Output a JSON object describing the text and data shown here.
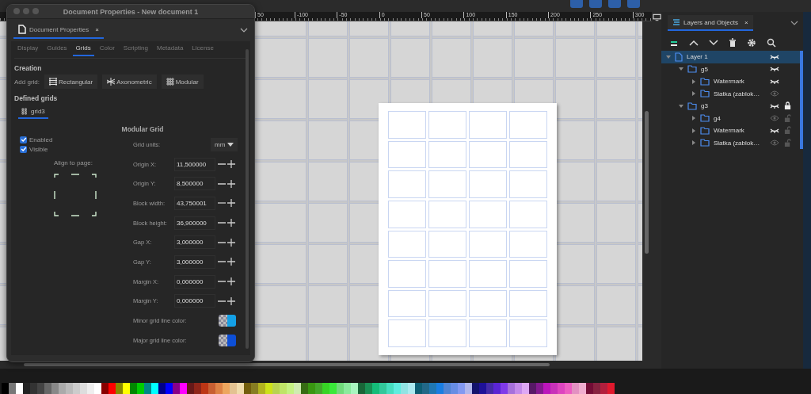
{
  "dialog": {
    "title": "Document Properties - New document 1",
    "panel_tab": "Document Properties",
    "close": "×",
    "tabs": [
      {
        "label": "Display",
        "selected": false
      },
      {
        "label": "Guides",
        "selected": false
      },
      {
        "label": "Grids",
        "selected": true
      },
      {
        "label": "Color",
        "selected": false
      },
      {
        "label": "Scripting",
        "selected": false
      },
      {
        "label": "Metadata",
        "selected": false
      },
      {
        "label": "License",
        "selected": false
      }
    ],
    "creation": {
      "heading": "Creation",
      "label": "Add grid:",
      "buttons": [
        {
          "label": "Rectangular",
          "kind": "rect"
        },
        {
          "label": "Axonometric",
          "kind": "axo"
        },
        {
          "label": "Modular",
          "kind": "modular"
        }
      ]
    },
    "defined": {
      "heading": "Defined grids",
      "grids": [
        {
          "label": "grid3",
          "selected": true
        }
      ]
    },
    "grid": {
      "heading": "Modular Grid",
      "checks": [
        {
          "label": "Enabled",
          "checked": true
        },
        {
          "label": "Visible",
          "checked": true
        }
      ],
      "align_label": "Align to page:",
      "units": {
        "label": "Grid units:",
        "value": "mm"
      },
      "fields": [
        {
          "kind": "spin",
          "label": "Origin X:",
          "value": "11,500000"
        },
        {
          "kind": "spin",
          "label": "Origin Y:",
          "value": "8,500000"
        },
        {
          "kind": "spin",
          "label": "Block width:",
          "value": "43,750001"
        },
        {
          "kind": "spin",
          "label": "Block height:",
          "value": "36,900000"
        },
        {
          "kind": "spin",
          "label": "Gap X:",
          "value": "3,000000"
        },
        {
          "kind": "spin",
          "label": "Gap Y:",
          "value": "3,000000"
        },
        {
          "kind": "spin",
          "label": "Margin X:",
          "value": "0,000000"
        },
        {
          "kind": "spin",
          "label": "Margin Y:",
          "value": "0,000000"
        },
        {
          "kind": "color",
          "label": "Minor grid line color:",
          "color": "#14a0e6"
        },
        {
          "kind": "color",
          "label": "Major grid line color:",
          "color": "#0d4fd6"
        }
      ]
    }
  },
  "ruler": {
    "left_label": "50",
    "ticks": [
      "-100",
      "-50",
      "0",
      "50",
      "100",
      "150",
      "200",
      "250",
      "300"
    ]
  },
  "layers": {
    "title": "Layers and Objects",
    "close": "×",
    "tree": [
      {
        "label": "Layer 1",
        "kind": "layer",
        "selected": true,
        "expanded": true,
        "visible": true,
        "children": [
          {
            "label": "g5",
            "kind": "group",
            "selected": false,
            "expanded": true,
            "visible": true,
            "children": [
              {
                "label": "Watermark",
                "kind": "group",
                "selected": false,
                "expanded": false,
                "visible": true
              },
              {
                "label": "Siatka (zablok…",
                "kind": "group",
                "selected": false,
                "expanded": false,
                "visible": false
              }
            ]
          },
          {
            "label": "g3",
            "kind": "group",
            "selected": false,
            "expanded": true,
            "visible": true,
            "locked": true,
            "children": [
              {
                "label": "g4",
                "kind": "group",
                "selected": false,
                "expanded": false,
                "visible": false,
                "locked": false
              },
              {
                "label": "Watermark",
                "kind": "group",
                "selected": false,
                "expanded": false,
                "visible": true,
                "locked": false
              },
              {
                "label": "Siatka (zablok…",
                "kind": "group",
                "selected": false,
                "expanded": false,
                "visible": false,
                "locked": false
              }
            ]
          }
        ]
      }
    ]
  }
}
